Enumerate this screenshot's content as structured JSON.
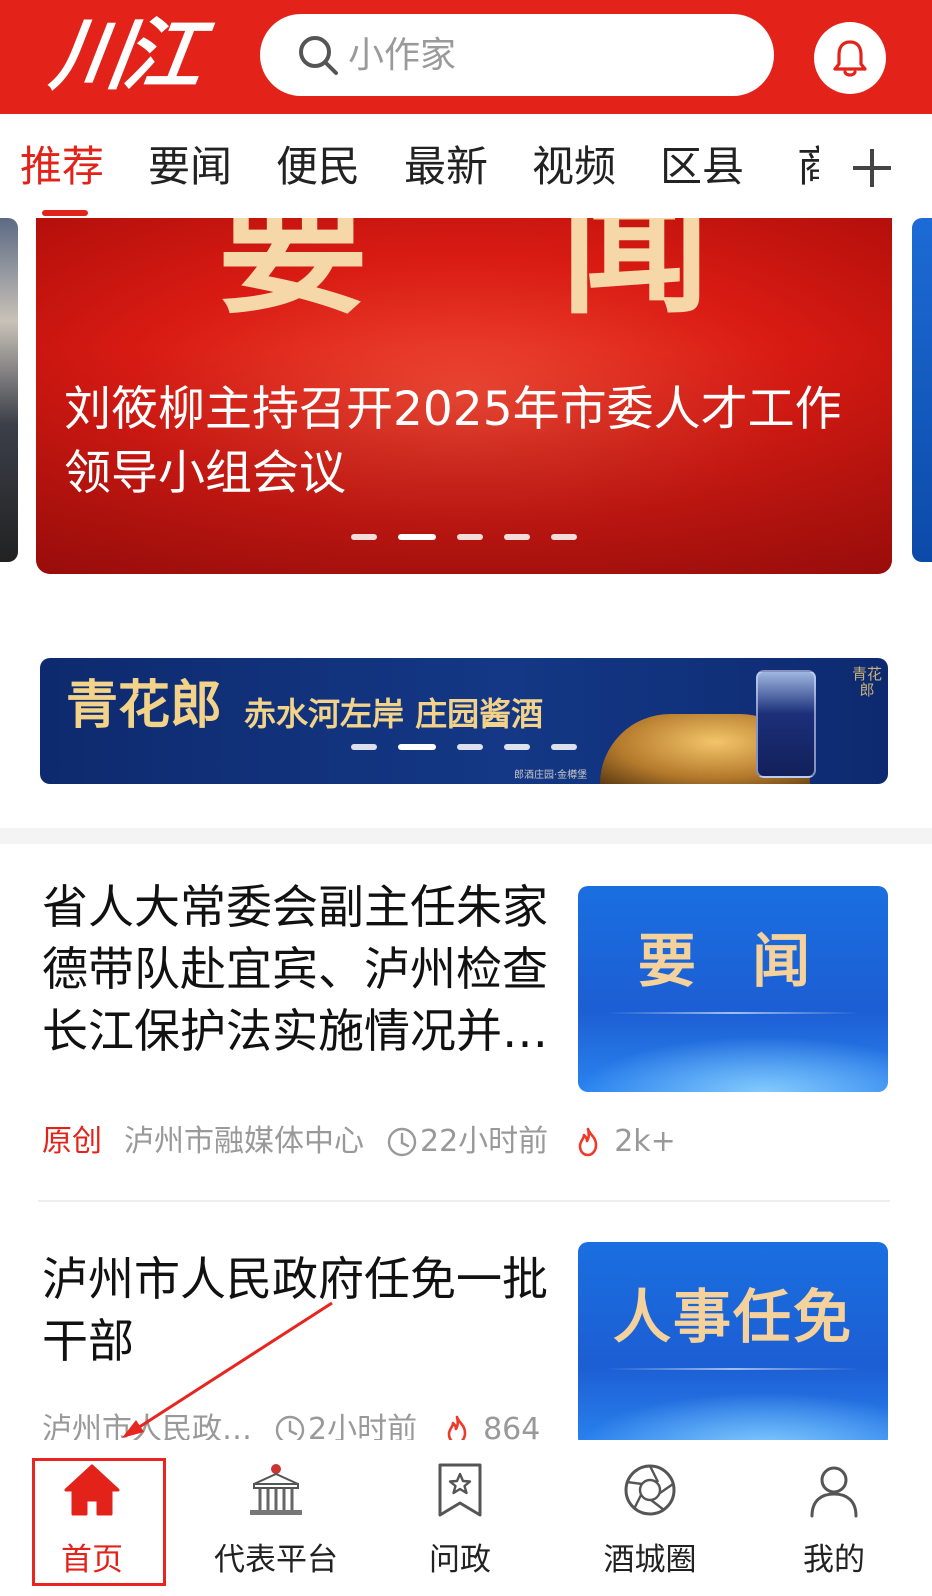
{
  "header": {
    "logo_text": "川江",
    "search_placeholder": "小作家",
    "search_icon": "search-icon",
    "bell_icon": "bell-icon",
    "brand_color": "#e32219"
  },
  "tabs": {
    "items": [
      "推荐",
      "要闻",
      "便民",
      "最新",
      "视频",
      "区县",
      "商"
    ],
    "active_index": 0,
    "plus_icon": "plus-icon"
  },
  "carousel": {
    "banner_text": "要 闻",
    "title": "刘筱柳主持召开2025年市委人才工作领导小组会议",
    "slide_count": 5,
    "active_slide": 1
  },
  "ad": {
    "brand": "青花郎",
    "tagline": "赤水河左岸  庄园酱酒",
    "small_text": "郎酒庄园·金樽堡",
    "seal_text": "青花郎",
    "slide_count": 5,
    "active_slide": 1
  },
  "news": [
    {
      "title": "省人大常委会副主任朱家德带队赴宜宾、泸州检查长江保护法实施情况并…",
      "thumb_text": "要 闻",
      "origin_label": "原创",
      "source": "泸州市融媒体中心",
      "time": "22小时前",
      "heat": "2k+"
    },
    {
      "title": "泸州市人民政府任免一批干部",
      "thumb_text": "人事任免",
      "origin_label": "",
      "source": "泸州市人民政…",
      "time": "2小时前",
      "heat": "864"
    }
  ],
  "bottom_nav": {
    "items": [
      {
        "label": "首页",
        "icon": "home-icon",
        "active": true
      },
      {
        "label": "代表平台",
        "icon": "building-icon",
        "active": false
      },
      {
        "label": "问政",
        "icon": "bookmark-star-icon",
        "active": false
      },
      {
        "label": "酒城圈",
        "icon": "aperture-icon",
        "active": false
      },
      {
        "label": "我的",
        "icon": "user-icon",
        "active": false
      }
    ]
  },
  "annotation_color": "#e8251f"
}
